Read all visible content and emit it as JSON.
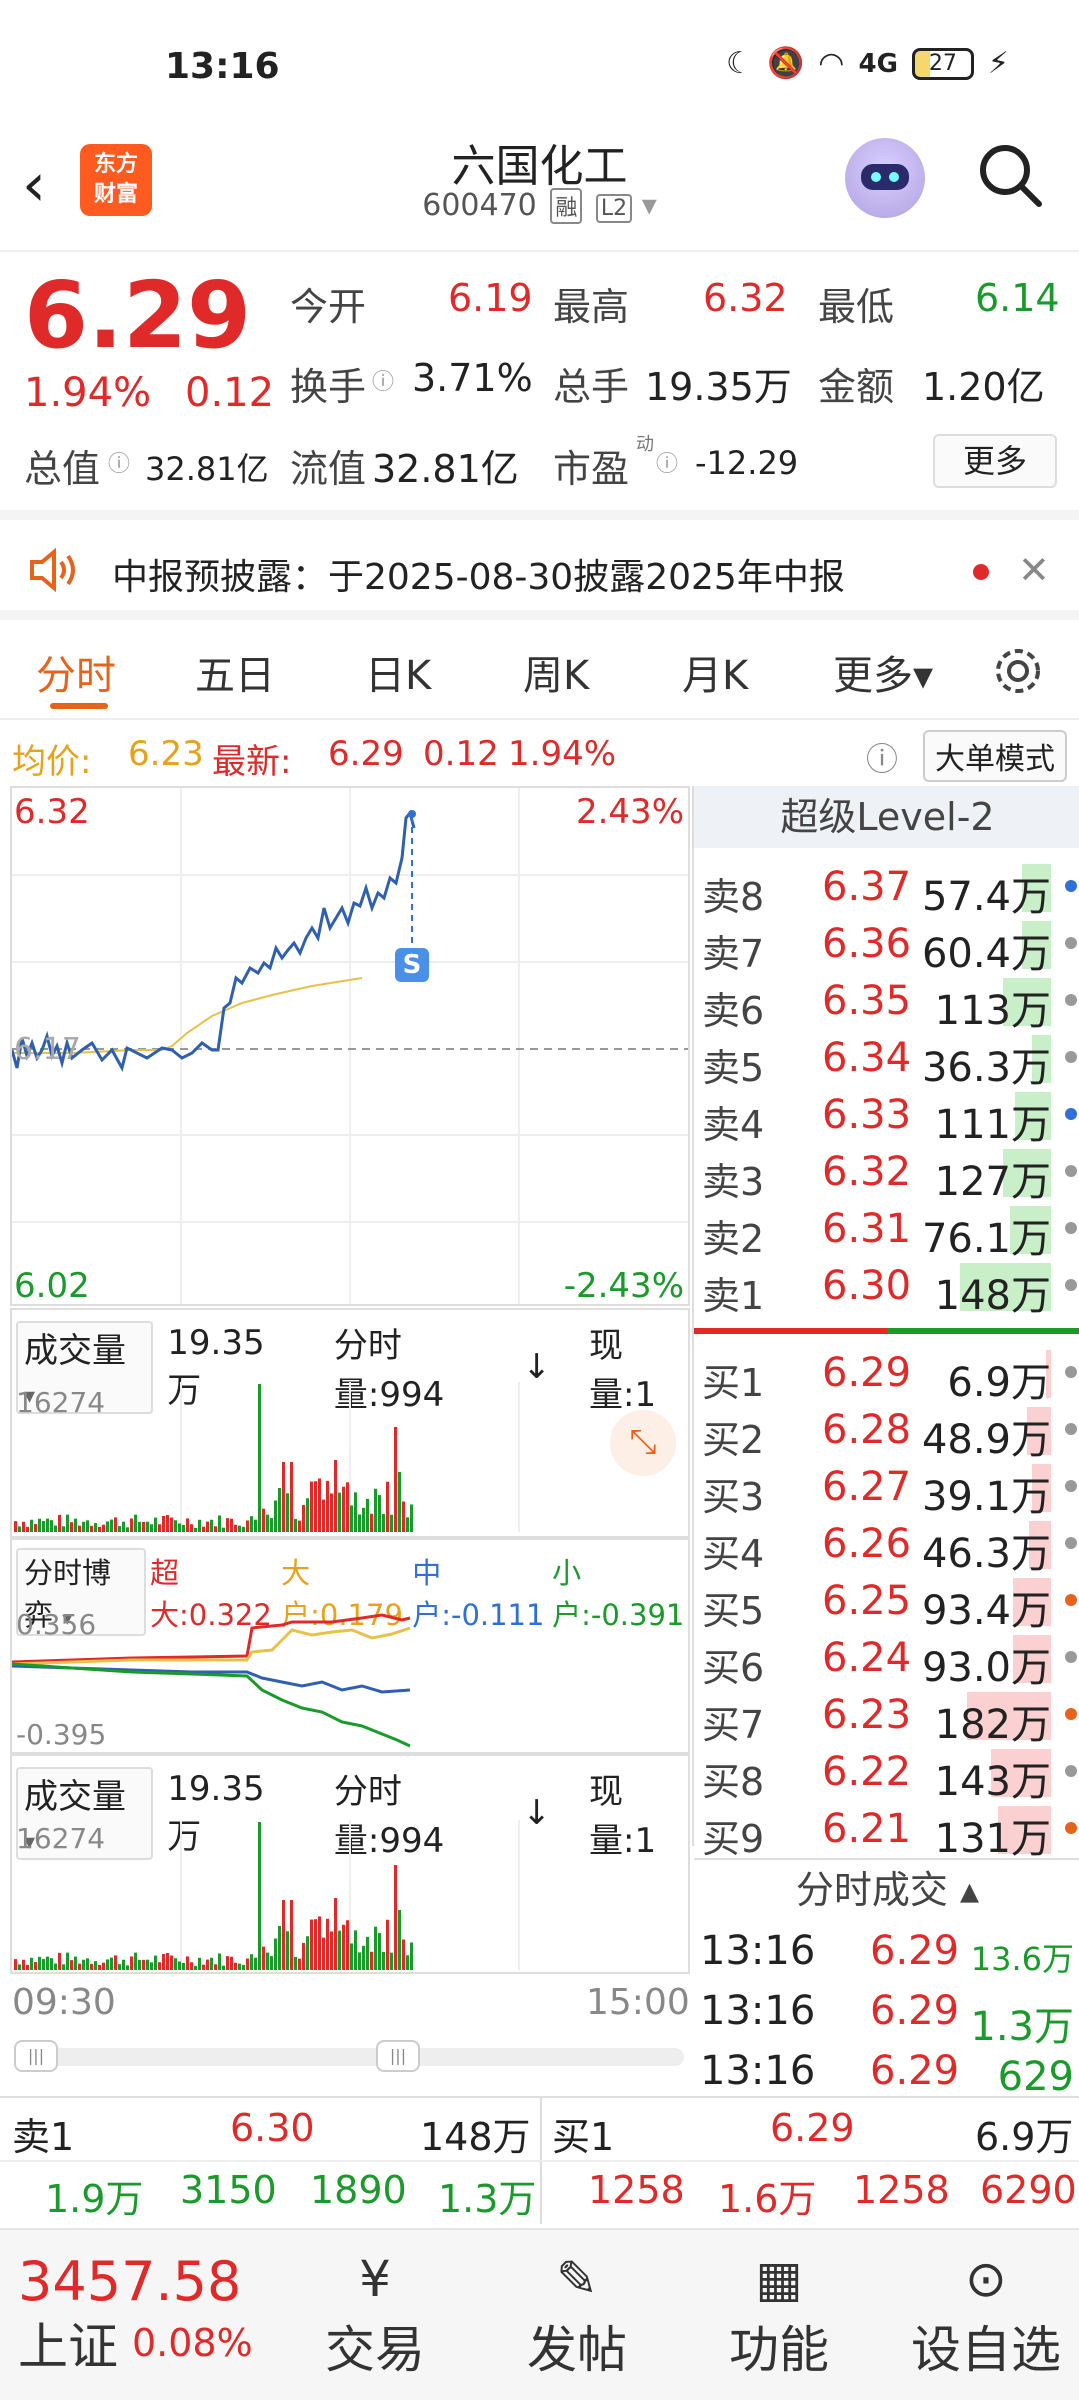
{
  "status": {
    "time": "13:16",
    "network": "4G",
    "battery": "27"
  },
  "header": {
    "back": "‹",
    "logo_line1": "东方",
    "logo_line2": "财富",
    "title": "六国化工",
    "code": "600470",
    "tag1": "融",
    "tag2": "L2"
  },
  "quote": {
    "price": "6.29",
    "pct": "1.94%",
    "change": "0.12",
    "open_label": "今开",
    "open": "6.19",
    "high_label": "最高",
    "high": "6.32",
    "low_label": "最低",
    "low": "6.14",
    "turnover_label": "换手",
    "turnover": "3.71%",
    "volume_label": "总手",
    "volume": "19.35万",
    "amount_label": "金额",
    "amount": "1.20亿",
    "mcap_label": "总值",
    "mcap": "32.81亿",
    "float_label": "流值",
    "float": "32.81亿",
    "pe_label": "市盈",
    "pe_sup": "动",
    "pe": "-12.29",
    "more": "更多"
  },
  "notice": {
    "text": "中报预披露：于2025-08-30披露2025年中报",
    "close": "✕"
  },
  "tabs": [
    "分时",
    "五日",
    "日K",
    "周K",
    "月K",
    "更多▾"
  ],
  "avg": {
    "avg_label": "均价:",
    "avg": "6.23",
    "latest_label": "最新:",
    "latest": "6.29",
    "chg": "0.12",
    "pct": "1.94%",
    "mode": "大单模式"
  },
  "chart": {
    "top_price": "6.32",
    "top_pct": "2.43%",
    "bottom_price": "6.02",
    "bottom_pct": "-2.43%",
    "mid_price": "6.17",
    "marker": "S"
  },
  "vol1": {
    "sel": "成交量",
    "total": "19.35万",
    "tick_label": "分时量:994",
    "arrow": "↓",
    "now_label": "现量:1",
    "max": "16274"
  },
  "game": {
    "sel": "分时博弈",
    "super": "超大:0.322",
    "big": "大户:0.179",
    "mid": "中户:-0.111",
    "small": "小户:-0.391",
    "max": "0.356",
    "min": "-0.395"
  },
  "vol2": {
    "sel": "成交量",
    "total": "19.35万",
    "tick_label": "分时量:994",
    "arrow": "↓",
    "now_label": "现量:1",
    "max": "16274"
  },
  "time_axis": {
    "start": "09:30",
    "end": "15:00"
  },
  "book": {
    "title": "超级Level-2",
    "asks": [
      {
        "label": "卖8",
        "price": "6.37",
        "vol": "57.4万",
        "bar": 0.12,
        "mark": "#2f6fd6"
      },
      {
        "label": "卖7",
        "price": "6.36",
        "vol": "60.4万",
        "bar": 0.12,
        "mark": "#999999"
      },
      {
        "label": "卖6",
        "price": "6.35",
        "vol": "113万",
        "bar": 0.2,
        "mark": "#999999"
      },
      {
        "label": "卖5",
        "price": "6.34",
        "vol": "36.3万",
        "bar": 0.08,
        "mark": "#999999"
      },
      {
        "label": "卖4",
        "price": "6.33",
        "vol": "111万",
        "bar": 0.15,
        "mark": "#2f6fd6"
      },
      {
        "label": "卖3",
        "price": "6.32",
        "vol": "127万",
        "bar": 0.2,
        "mark": "#999999"
      },
      {
        "label": "卖2",
        "price": "6.31",
        "vol": "76.1万",
        "bar": 0.17,
        "mark": "#999999"
      },
      {
        "label": "卖1",
        "price": "6.30",
        "vol": "148万",
        "bar": 0.38,
        "mark": "#999999"
      }
    ],
    "bids": [
      {
        "label": "买1",
        "price": "6.29",
        "vol": "6.9万",
        "bar": 0.02,
        "mark": "#999999"
      },
      {
        "label": "买2",
        "price": "6.28",
        "vol": "48.9万",
        "bar": 0.1,
        "mark": "#999999"
      },
      {
        "label": "买3",
        "price": "6.27",
        "vol": "39.1万",
        "bar": 0.08,
        "mark": "#999999"
      },
      {
        "label": "买4",
        "price": "6.26",
        "vol": "46.3万",
        "bar": 0.09,
        "mark": "#999999"
      },
      {
        "label": "买5",
        "price": "6.25",
        "vol": "93.4万",
        "bar": 0.16,
        "mark": "#e8631a"
      },
      {
        "label": "买6",
        "price": "6.24",
        "vol": "93.0万",
        "bar": 0.16,
        "mark": "#999999"
      },
      {
        "label": "买7",
        "price": "6.23",
        "vol": "182万",
        "bar": 0.35,
        "mark": "#e8631a"
      },
      {
        "label": "买8",
        "price": "6.22",
        "vol": "143万",
        "bar": 0.25,
        "mark": "#999999"
      },
      {
        "label": "买9",
        "price": "6.21",
        "vol": "131万",
        "bar": 0.22,
        "mark": "#e8631a"
      }
    ],
    "trades_title": "分时成交 ▴",
    "trades": [
      {
        "time": "13:16",
        "price": "6.29",
        "vol": "13.6万",
        "color": "#1a9a2a"
      },
      {
        "time": "13:16",
        "price": "6.29",
        "vol": "1.3万",
        "color": "#1a9a2a"
      },
      {
        "time": "13:16",
        "price": "6.29",
        "vol": "629",
        "color": "#1a9a2a"
      }
    ]
  },
  "summary": {
    "sell_label": "卖1",
    "sell_price": "6.30",
    "sell_vol": "148万",
    "buy_label": "买1",
    "buy_price": "6.29",
    "buy_vol": "6.9万",
    "sell_row": [
      "1.9万",
      "3150",
      "1890",
      "1.3万"
    ],
    "buy_row": [
      "1258",
      "1.6万",
      "1258",
      "6290"
    ]
  },
  "bottom": {
    "index_value": "3457.58",
    "index_name": "上证",
    "index_pct": "0.08%",
    "items": [
      "交易",
      "发帖",
      "功能",
      "设自选"
    ]
  }
}
